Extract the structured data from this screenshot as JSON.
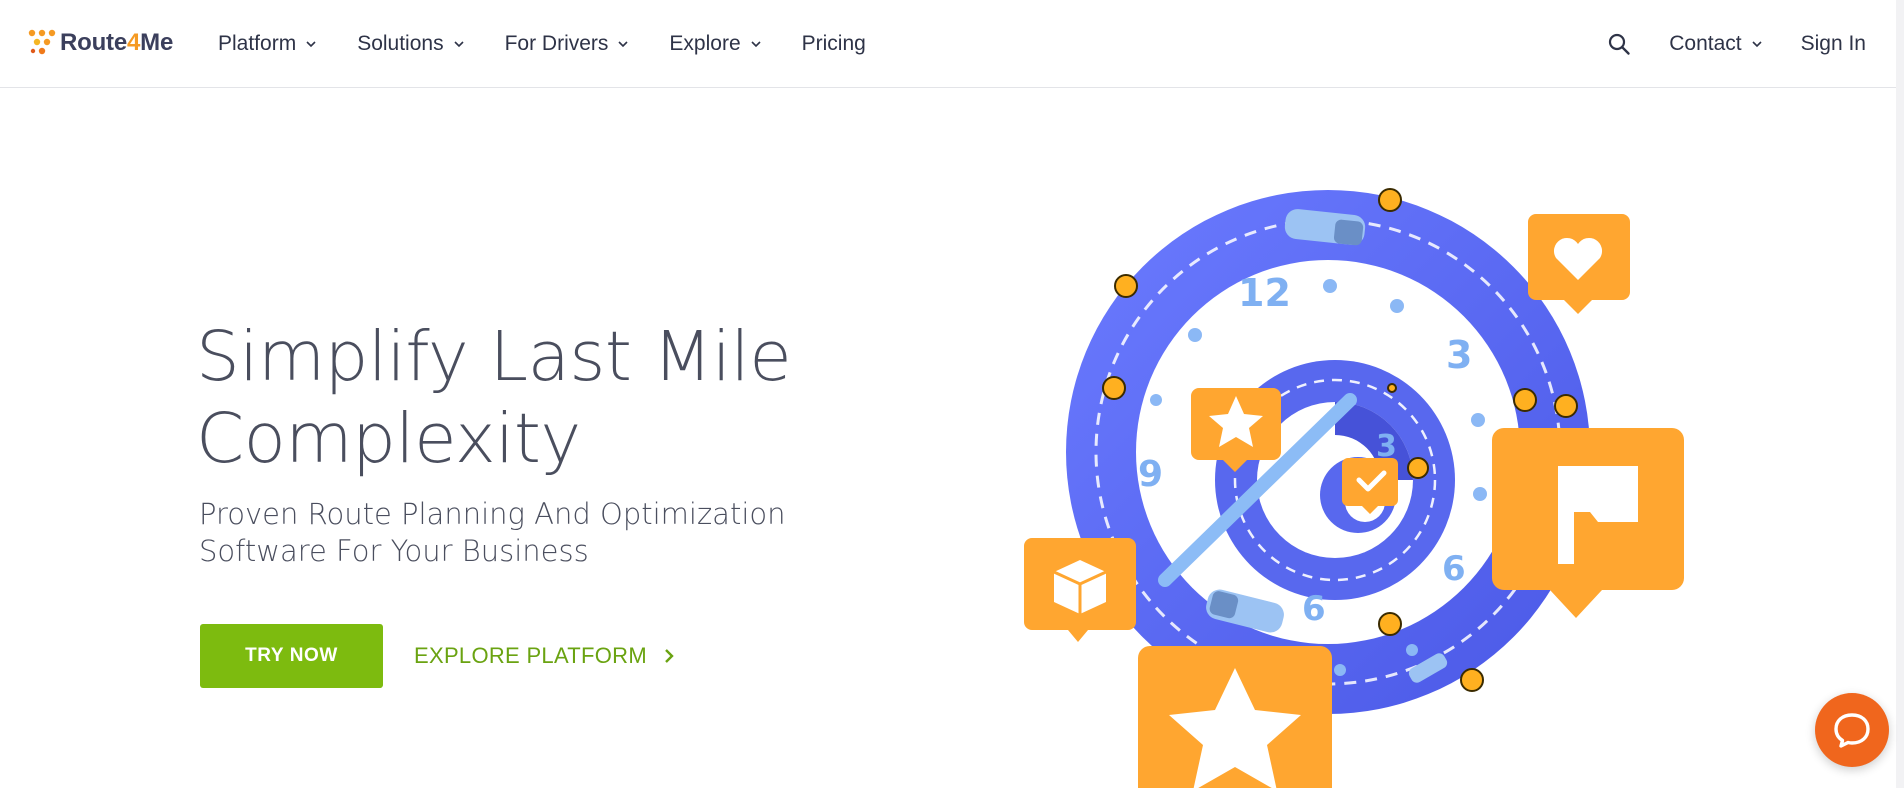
{
  "brand": {
    "name_prefix": "Route",
    "name_four": "4",
    "name_suffix": "Me",
    "accent": "#f59a23"
  },
  "nav": {
    "items": [
      {
        "label": "Platform",
        "dropdown": true
      },
      {
        "label": "Solutions",
        "dropdown": true
      },
      {
        "label": "For Drivers",
        "dropdown": true
      },
      {
        "label": "Explore",
        "dropdown": true
      },
      {
        "label": "Pricing",
        "dropdown": false
      }
    ],
    "contact_label": "Contact",
    "signin_label": "Sign In",
    "search_icon": "search-icon"
  },
  "hero": {
    "title_line1": "Simplify Last Mile",
    "title_line2": "Complexity",
    "subtitle_line1": "Proven Route Planning And Optimization",
    "subtitle_line2": "Software For Your Business",
    "primary_button": "TRY NOW",
    "secondary_link": "EXPLORE PLATFORM"
  },
  "illustration": {
    "clock_numbers": [
      "12",
      "3",
      "9",
      "6",
      "6",
      "3"
    ],
    "icons": [
      "heart-icon",
      "star-icon",
      "check-icon",
      "flag-icon",
      "box-icon",
      "star-icon"
    ]
  },
  "colors": {
    "primary_green": "#7dbb0f",
    "link_green": "#6aa311",
    "track_blue": "#5868ee",
    "badge_orange": "#ffa630",
    "chat_orange": "#f0661d"
  },
  "chat": {
    "icon": "chat-bubble-icon"
  }
}
